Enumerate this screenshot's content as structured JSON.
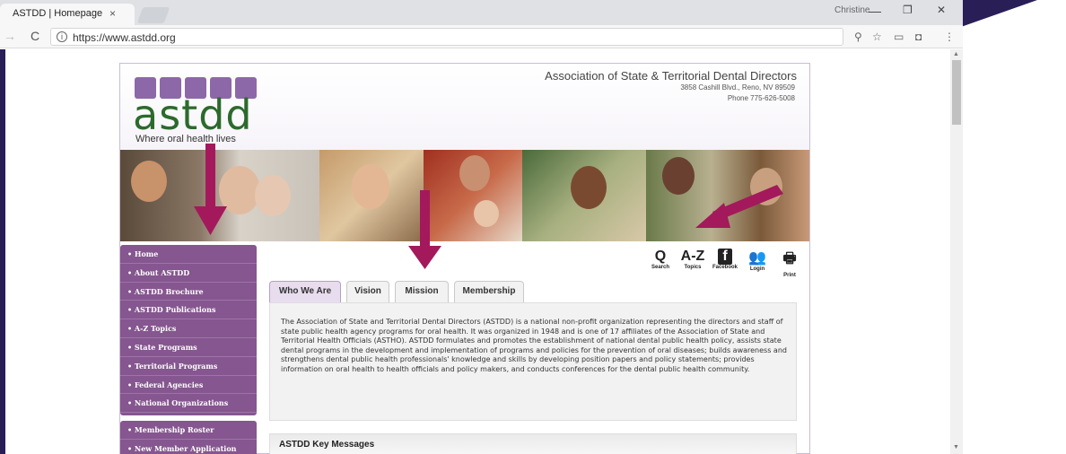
{
  "browser": {
    "tab_title": "ASTDD | Homepage",
    "tab_close": "×",
    "user_name": "Christine",
    "url": "https://www.astdd.org",
    "window_controls": [
      "—",
      "❐",
      "✕"
    ]
  },
  "site": {
    "logo_text": "astdd",
    "tagline": "Where oral health lives",
    "org_name": "Association of State & Territorial Dental Directors",
    "address": "3858 Cashill Blvd., Reno, NV 89509",
    "phone": "Phone 775-626-5008"
  },
  "nav": {
    "items": [
      {
        "label": "Home"
      },
      {
        "label": "About ASTDD"
      },
      {
        "label": "ASTDD Brochure"
      },
      {
        "label": "ASTDD Publications"
      },
      {
        "label": "A-Z Topics"
      },
      {
        "label": "State Programs"
      },
      {
        "label": "Territorial Programs"
      },
      {
        "label": "Federal Agencies"
      },
      {
        "label": "National Organizations"
      }
    ],
    "items2": [
      {
        "label": "Membership Roster"
      },
      {
        "label": "New Member Application"
      }
    ]
  },
  "tools": [
    {
      "glyph": "Q",
      "label": "Search",
      "icon": "search-icon"
    },
    {
      "glyph": "A-Z",
      "label": "Topics",
      "icon": "az-topics-icon"
    },
    {
      "glyph": "f",
      "label": "Facebook",
      "icon": "facebook-icon"
    },
    {
      "glyph": "👥",
      "label": "Login",
      "icon": "login-icon"
    },
    {
      "glyph": "🖶",
      "label": "Print",
      "icon": "print-icon"
    }
  ],
  "tabs": [
    {
      "label": "Who We Are",
      "active": true
    },
    {
      "label": "Vision",
      "active": false
    },
    {
      "label": "Mission",
      "active": false
    },
    {
      "label": "Membership",
      "active": false
    }
  ],
  "content": {
    "body": "The Association of State and Territorial Dental Directors (ASTDD) is a national non-profit organization representing the directors and staff of state public health agency programs for oral health. It was organized in 1948 and is one of 17 affiliates of the Association of State and Territorial Health Officials (ASTHO). ASTDD formulates and promotes the establishment of national dental public health policy, assists state dental programs in the development and implementation of programs and policies for the prevention of oral diseases; builds awareness and strengthens dental public health professionals' knowledge and skills by developing position papers and policy statements; provides information on oral health to health officials and policy makers, and conducts conferences for the dental public health community.",
    "key_messages_title": "ASTDD Key Messages"
  },
  "colors": {
    "accent_purple": "#85568f",
    "arrow_magenta": "#a3195b",
    "logo_green": "#2c6a2c"
  }
}
